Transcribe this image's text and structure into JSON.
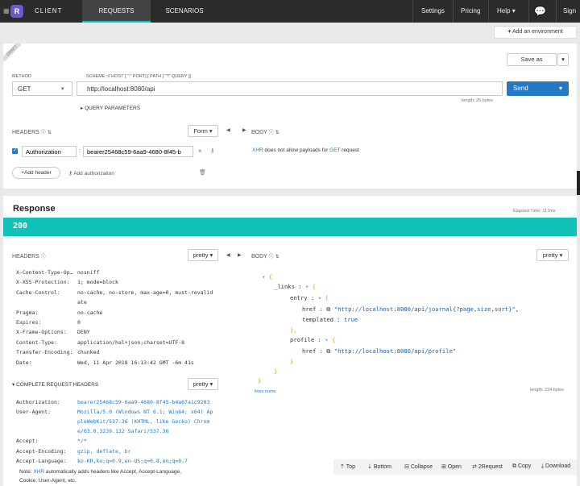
{
  "app": {
    "title": "CLIENT",
    "logo_letter": "R"
  },
  "nav": {
    "requests": "REQUESTS",
    "scenarios": "SCENARIOS",
    "settings": "Settings",
    "pricing": "Pricing",
    "help": "Help",
    "sign": "Sign"
  },
  "env": {
    "add": "Add an environment"
  },
  "draft": "DRAFT",
  "request": {
    "method_label": "METHOD",
    "method": "GET",
    "url_label": "SCHEME :// HOST [ \":\" PORT] [ PATH [ \"?\" QUERY ]]",
    "url": "http://localhost:8080/api",
    "length": "length: 25 bytes",
    "save": "Save as",
    "send": "Send",
    "query_params": "QUERY PARAMETERS",
    "headers_label": "HEADERS",
    "form": "Form",
    "body_label": "BODY",
    "header_name": "Authorization",
    "header_value": "bearer25468c59-6aa9-4680-8f45-b",
    "add_header": "Add header",
    "add_auth": "Add authorization",
    "body_note_link": "XHR",
    "body_note": " does not allow payloads for ",
    "body_note_get": "GET",
    "body_note_end": " request"
  },
  "response": {
    "title": "Response",
    "elapsed": "Elapsed Time: 117ms",
    "status": "200",
    "headers_label": "HEADERS",
    "pretty": "pretty",
    "body_label": "BODY",
    "headers": [
      {
        "k": "X-Content-Type-Op…",
        "v": "nosniff"
      },
      {
        "k": "X-XSS-Protection:",
        "v": "1; mode=block"
      },
      {
        "k": "Cache-Control:",
        "v": "no-cache, no-store, max-age=0, must-revalid"
      },
      {
        "k": "",
        "v": "ate"
      },
      {
        "k": "Pragma:",
        "v": "no-cache"
      },
      {
        "k": "Expires:",
        "v": "0"
      },
      {
        "k": "X-Frame-Options:",
        "v": "DENY"
      },
      {
        "k": "Content-Type:",
        "v": "application/hal+json;charset=UTF-8"
      },
      {
        "k": "Transfer-Encoding:",
        "v": "chunked"
      },
      {
        "k": "Date:",
        "v": "Wed, 11 Apr 2018 16:13:42 GMT -6m 41s"
      }
    ],
    "complete_label": "COMPLETE REQUEST HEADERS",
    "req_headers": [
      {
        "k": "Authorization:",
        "v": "bearer25468c59-6aa9-4680-8f45-b4a67a1c9203"
      },
      {
        "k": "User-Agent:",
        "v": "Mozilla/5.0 (Windows NT 6.1; Win64; x64) Ap"
      },
      {
        "k": "",
        "v": "pleWebKit/537.36 (KHTML, like Gecko) Chrom"
      },
      {
        "k": "",
        "v": "e/63.0.3239.132 Safari/537.36"
      },
      {
        "k": "Accept:",
        "v": "*/*"
      },
      {
        "k": "Accept-Encoding:",
        "v": "gzip, deflate, br"
      },
      {
        "k": "Accept-Language:",
        "v": "ko-KR,ko;q=0.9,en-US;q=0.8,en;q=0.7"
      }
    ],
    "note_a": "Note: ",
    "note_link": "XHR",
    "note_b": " automatically adds headers like Accept, Accept-Language,",
    "note_c": "Cookie, User-Agent, etc.",
    "json": {
      "open": "{",
      "links": "_links",
      "entry": "entry",
      "href": "href",
      "entry_href": "\"http://localhost:8080/api/journal{?page,size,sort}\"",
      "templated": "templated",
      "true": "true",
      "profile": "profile",
      "profile_href": "\"http://localhost:8080/api/profile\"",
      "close_inner": "}",
      "close_entry": "},",
      "close": "}"
    },
    "lines_nums": "lines nums",
    "length": "length: 224 bytes",
    "toolbar": [
      "Top",
      "Bottom",
      "Collapse",
      "Open",
      "2Request",
      "Copy",
      "Download"
    ]
  }
}
